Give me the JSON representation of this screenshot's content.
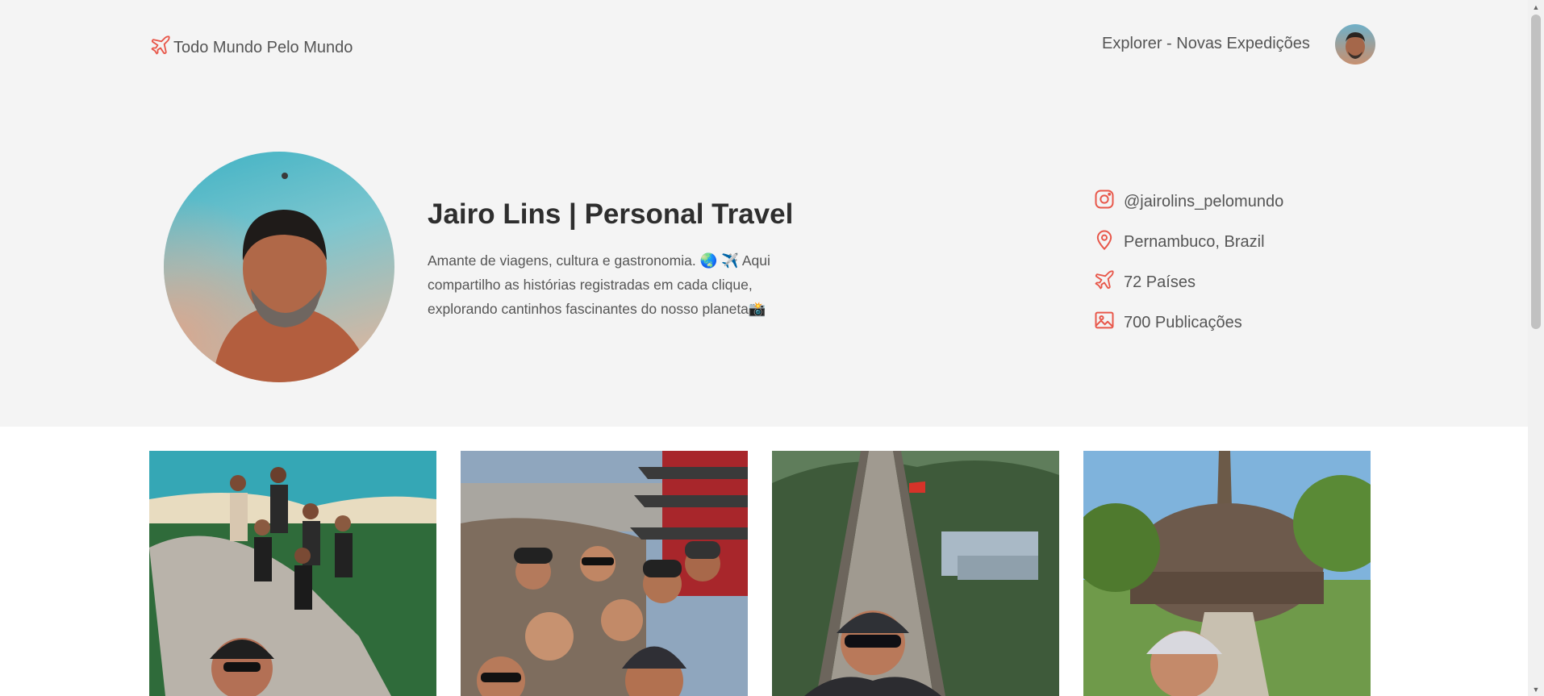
{
  "nav": {
    "brand_label": "Todo Mundo Pelo Mundo",
    "explore_link": "Explorer - Novas Expedições"
  },
  "profile": {
    "name": "Jairo Lins | Personal Travel",
    "bio": "Amante de viagens, cultura e gastronomia. 🌏 ✈️ Aqui compartilho as histórias registradas em cada clique, explorando cantinhos fascinantes do nosso planeta📸"
  },
  "info": {
    "instagram": "@jairolins_pelomundo",
    "location": "Pernambuco, Brazil",
    "countries": "72 Países",
    "posts": "700 Publicações"
  },
  "icons": {
    "brand": "plane-icon",
    "instagram": "instagram-icon",
    "location": "map-pin-icon",
    "countries": "plane-icon",
    "posts": "image-icon"
  },
  "colors": {
    "accent": "#e8574a",
    "header_bg": "#f4f4f4",
    "text": "#555555",
    "title": "#2e2e2e"
  }
}
